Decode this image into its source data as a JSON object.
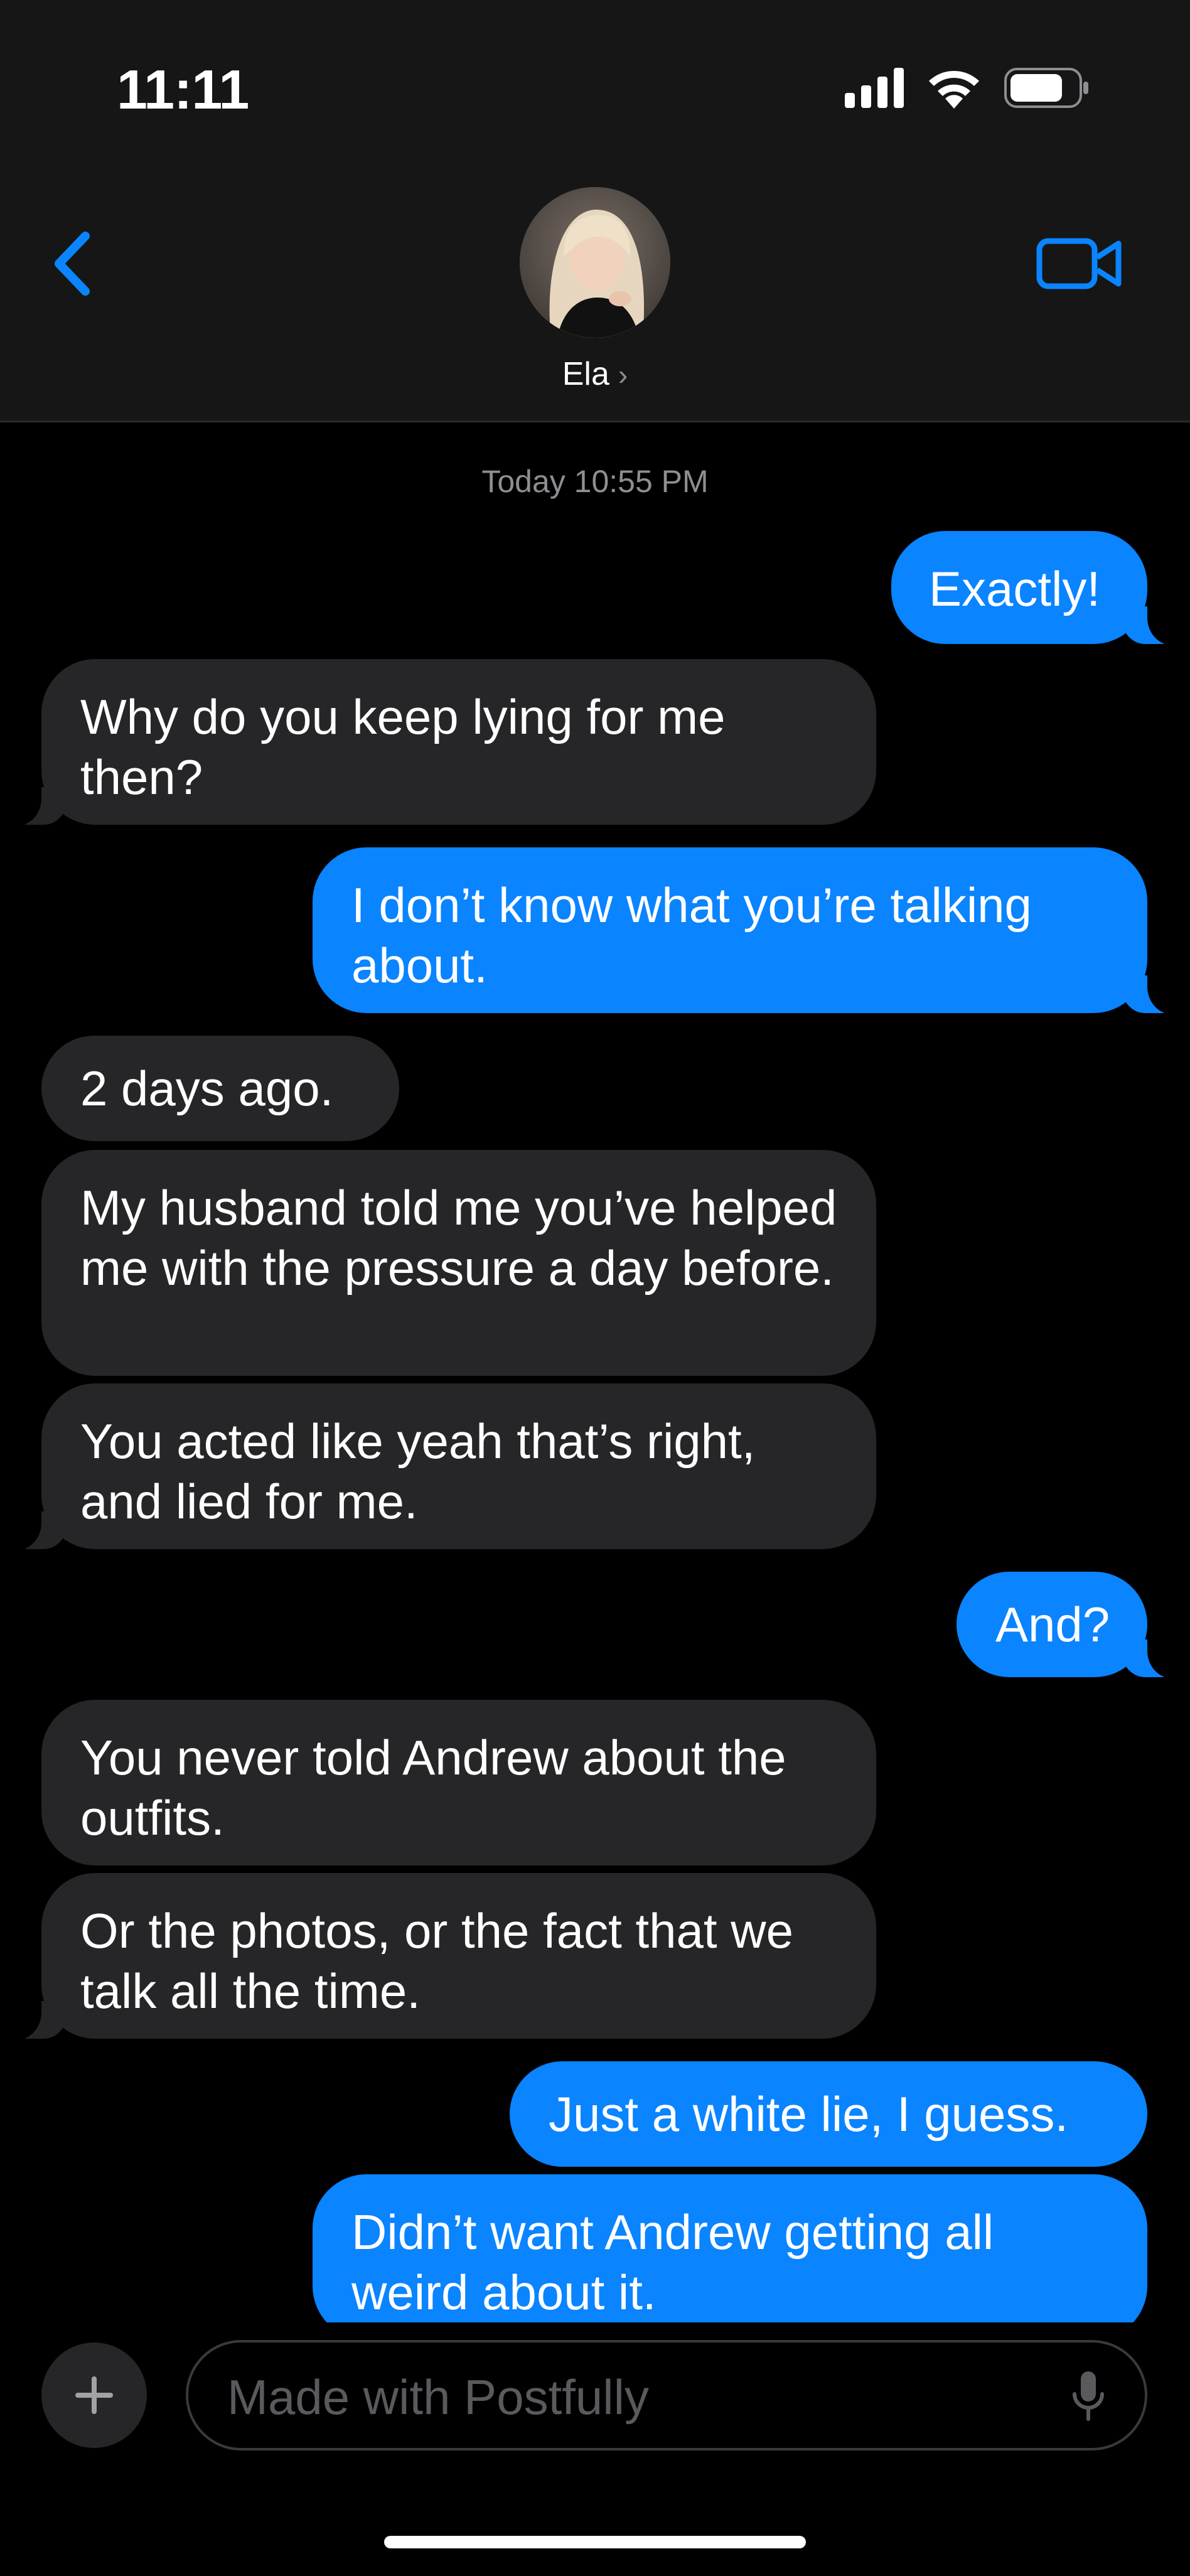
{
  "status_bar": {
    "time": "11:11"
  },
  "header": {
    "contact_name": "Ela",
    "name_chevron": "›",
    "icons": {
      "back": "chevron-left-icon",
      "video": "video-camera-icon"
    },
    "accent_color": "#0a84ff"
  },
  "conversation": {
    "timestamp": "Today 10:55 PM",
    "messages": [
      {
        "from": "me",
        "text": "Exactly!"
      },
      {
        "from": "them",
        "text": "Why do you keep lying for me then?"
      },
      {
        "from": "me",
        "text": "I don’t know what you’re talking about."
      },
      {
        "from": "them",
        "text": "2 days ago."
      },
      {
        "from": "them",
        "text": "My husband told me you’ve helped me with the pressure a day before."
      },
      {
        "from": "them",
        "text": "You acted like yeah that’s right, and lied for me."
      },
      {
        "from": "me",
        "text": "And?"
      },
      {
        "from": "them",
        "text": "You never told Andrew about the outfits."
      },
      {
        "from": "them",
        "text": "Or the photos, or the fact that we talk all the time."
      },
      {
        "from": "me",
        "text": "Just a white lie, I guess."
      },
      {
        "from": "me",
        "text": "Didn’t want Andrew getting all weird about it."
      }
    ]
  },
  "composer": {
    "placeholder": "Made with Postfully",
    "icons": {
      "plus": "plus-icon",
      "mic": "microphone-icon"
    }
  }
}
